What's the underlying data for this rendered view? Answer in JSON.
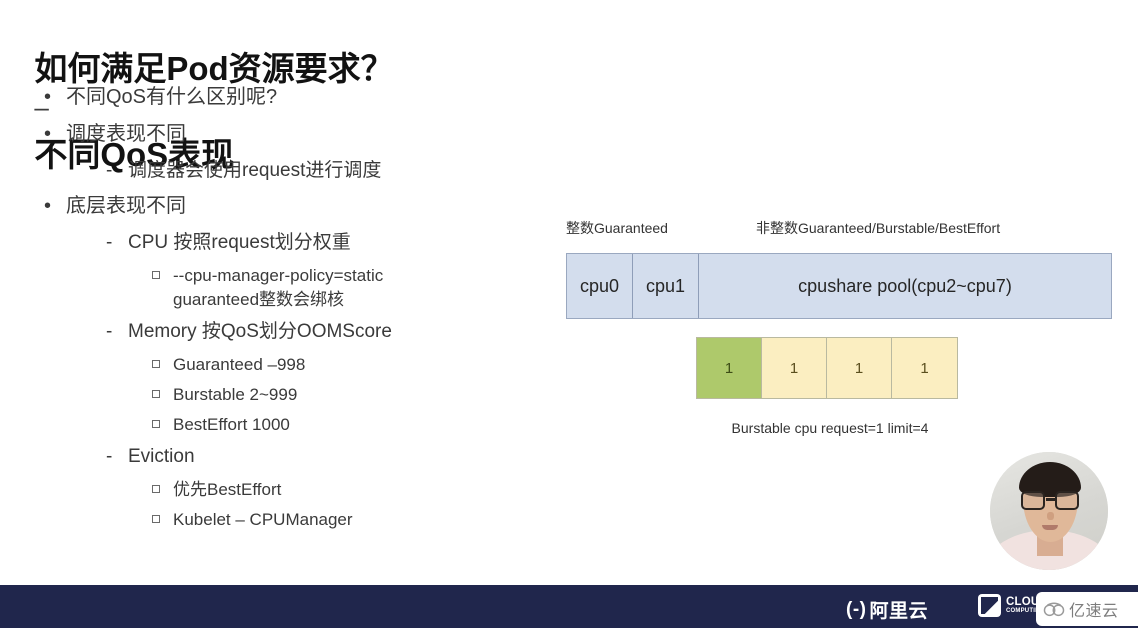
{
  "slide": {
    "title_main": "如何满足Pod资源要求？",
    "title_separator": "–",
    "title_sub": "不同QoS表现"
  },
  "bullets": [
    {
      "level": 1,
      "marker": "•",
      "text": "不同QoS有什么区别呢?"
    },
    {
      "level": 1,
      "marker": "•",
      "text": "调度表现不同"
    },
    {
      "level": 2,
      "marker": "-",
      "text": "调度器会使用request进行调度"
    },
    {
      "level": 1,
      "marker": "•",
      "text": "底层表现不同"
    },
    {
      "level": 2,
      "marker": "-",
      "text": "CPU 按照request划分权重"
    },
    {
      "level": 3,
      "marker": "▫",
      "text": "--cpu-manager-policy=static\nguaranteed整数会绑核"
    },
    {
      "level": 2,
      "marker": "-",
      "text": "Memory 按QoS划分OOMScore"
    },
    {
      "level": 3,
      "marker": "▫",
      "text": "Guaranteed –998"
    },
    {
      "level": 3,
      "marker": "▫",
      "text": "Burstable 2~999"
    },
    {
      "level": 3,
      "marker": "▫",
      "text": "BestEffort 1000"
    },
    {
      "level": 2,
      "marker": "-",
      "text": "Eviction"
    },
    {
      "level": 3,
      "marker": "▫",
      "text": "优先BestEffort"
    },
    {
      "level": 3,
      "marker": "▫",
      "text": "Kubelet – CPUManager"
    }
  ],
  "diagram": {
    "label_integer": "整数Guaranteed",
    "label_noninteger": "非整数Guaranteed/Burstable/BestEffort",
    "cpu_cells": [
      {
        "name": "cpu0"
      },
      {
        "name": "cpu1"
      },
      {
        "name": "cpushare pool(cpu2~cpu7)"
      }
    ],
    "cpu_bar_fill": "#d3dded",
    "cpu_bar_border": "#9aa8c0",
    "burstable_boxes": [
      {
        "value": "1",
        "color": "green"
      },
      {
        "value": "1",
        "color": "yellow"
      },
      {
        "value": "1",
        "color": "yellow"
      },
      {
        "value": "1",
        "color": "yellow"
      }
    ],
    "green_color": "#aec96b",
    "yellow_color": "#fbeec1",
    "burstable_caption": "Burstable cpu request=1 limit=4"
  },
  "footer": {
    "background": "#20264c",
    "alibaba_mark": "(-)",
    "alibaba_text": "阿里云",
    "cncf_line1": "CLOUD NATIVE",
    "cncf_line2": "COMPUTING FOUNDATION"
  },
  "watermark": {
    "text": "亿速云"
  }
}
